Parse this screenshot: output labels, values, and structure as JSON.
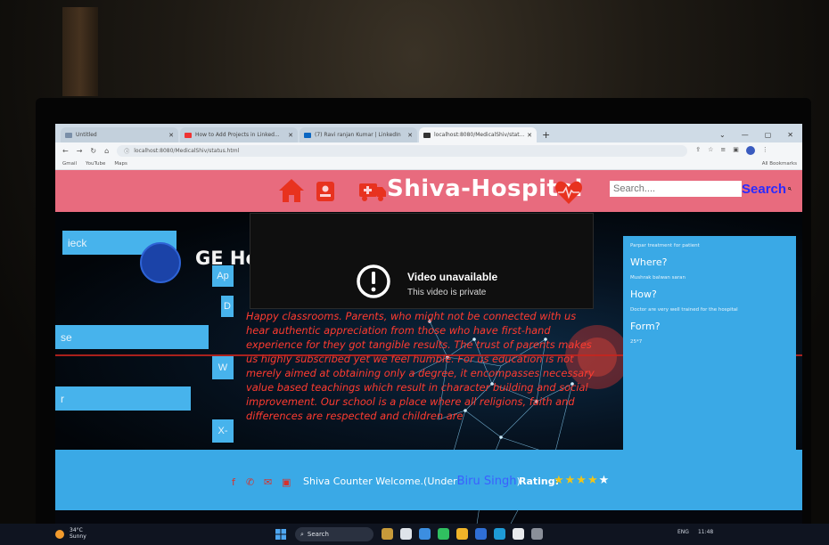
{
  "browser": {
    "tabs": [
      {
        "title": "Untitled",
        "color": "#7a8fa8",
        "active": false
      },
      {
        "title": "How to Add Projects in Linked...",
        "color": "#e33",
        "active": false
      },
      {
        "title": "(7) Ravi ranjan Kumar | LinkedIn",
        "color": "#0a66c2",
        "active": false
      },
      {
        "title": "localhost:8080/MedicalShiv/stat...",
        "color": "#333",
        "active": true
      }
    ],
    "url": "localhost:8080/MedicalShiv/status.html",
    "bookmarks": [
      "Gmail",
      "YouTube",
      "Maps"
    ],
    "all_bookmarks": "All Bookmarks"
  },
  "site": {
    "brand": "Shiva-Hospital",
    "search_placeholder": "Search....",
    "search_label": "Search",
    "colors": {
      "header": "#e86b7e",
      "panel": "#3aa9e6",
      "article_text": "#ff3b30"
    }
  },
  "left": {
    "btn1": "ieck",
    "btn2": "se",
    "btn3": "r",
    "ge_text": "GE He",
    "mini1": "Ap",
    "mini2": "D",
    "mini3": "W",
    "mini4": "X-"
  },
  "video": {
    "title": "Video unavailable",
    "subtitle": "This video is private"
  },
  "article": {
    "text": "Happy classrooms. Parents, who might not be connected with us hear authentic appreciation from those who have first-hand experience for they got tangible results. The trust of parents makes us highly subscribed yet we feel humble. For us education is not merely aimed at obtaining only a degree, it encompasses necessary value based teachings which result in character building and social improvement. Our school is a place where all religions, faith and differences are respected and children are"
  },
  "info": {
    "intro": "Parpar treatment for patient",
    "where_h": "Where?",
    "where_v": "Mushrak balwan saran",
    "how_h": "How?",
    "how_v": "Doctor are very well trained for the hospital",
    "form_h": "Form?",
    "form_v": "25*7"
  },
  "footer": {
    "welcome": "Shiva Counter Welcome.(Under",
    "name": "Biru Singh",
    "close_paren": ")",
    "rating_label": "Rating:",
    "rating": 4,
    "rating_max": 5,
    "stars": "★★★★",
    "star_empty": "★"
  },
  "taskbar": {
    "temp": "34°C",
    "weather": "Sunny",
    "search": "Search",
    "lang": "ENG",
    "time": "11:48"
  }
}
